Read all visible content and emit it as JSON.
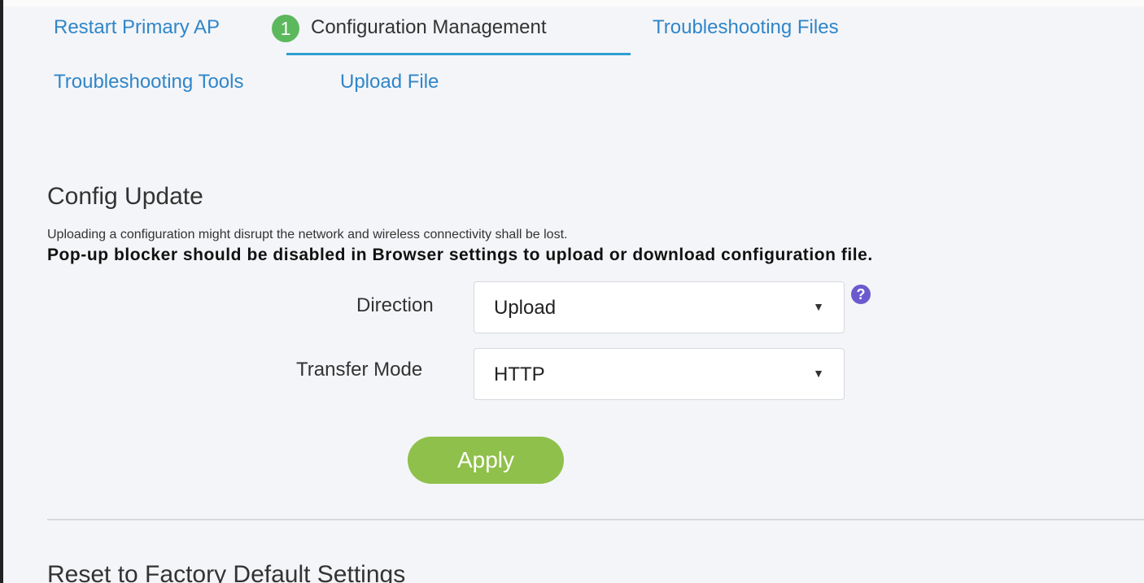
{
  "tabs": {
    "restart_primary_ap": "Restart Primary AP",
    "step_badge": "1",
    "configuration_management": "Configuration Management",
    "troubleshooting_files": "Troubleshooting Files",
    "troubleshooting_tools": "Troubleshooting Tools",
    "upload_file": "Upload File"
  },
  "config_update": {
    "title": "Config Update",
    "warning": "Uploading a configuration might disrupt the network and wireless connectivity shall be lost.",
    "popup_note": "Pop-up blocker should be disabled in Browser settings to upload or download configuration file.",
    "direction_label": "Direction",
    "direction_value": "Upload",
    "transfer_mode_label": "Transfer Mode",
    "transfer_mode_value": "HTTP",
    "caret": "▼",
    "help": "?",
    "apply_label": "Apply"
  },
  "reset_section": {
    "title": "Reset to Factory Default Settings"
  },
  "colors": {
    "link": "#2f86c9",
    "active_underline": "#2e9fd1",
    "badge": "#5cb85c",
    "apply_button": "#8fc04b",
    "help_icon": "#6a5acd"
  },
  "icons": {
    "help": "question-circle-icon",
    "dropdown": "caret-down-icon"
  }
}
